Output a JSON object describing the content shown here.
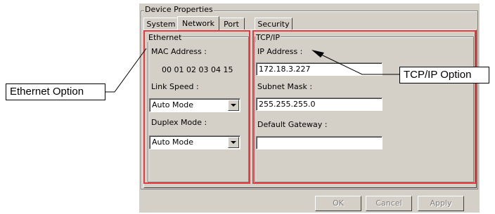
{
  "dialog": {
    "group_title": "Device Properties",
    "tabs": [
      "System",
      "Network",
      "Port",
      "Security"
    ],
    "active_tab": "Network"
  },
  "ethernet": {
    "legend": "Ethernet",
    "mac_label": "MAC Address :",
    "mac_value": "00 01 02 03 04 15",
    "link_speed_label": "Link Speed :",
    "link_speed_value": "Auto Mode",
    "duplex_label": "Duplex Mode :",
    "duplex_value": "Auto Mode"
  },
  "tcpip": {
    "legend": "TCP/IP",
    "ip_label": "IP Address :",
    "ip_value": "172.18.3.227",
    "subnet_label": "Subnet Mask :",
    "subnet_value": "255.255.255.0",
    "gateway_label": "Default Gateway :",
    "gateway_value": ""
  },
  "buttons": {
    "ok": "OK",
    "cancel": "Cancel",
    "apply": "Apply"
  },
  "callouts": {
    "ethernet": "Ethernet Option",
    "tcpip": "TCP/IP Option"
  },
  "colors": {
    "highlight": "#e8393d",
    "dialog_bg": "#d4d0c8"
  }
}
